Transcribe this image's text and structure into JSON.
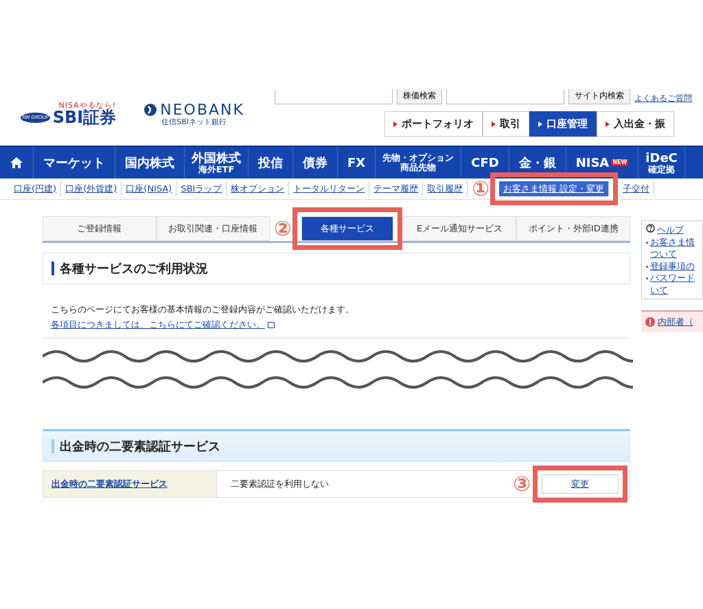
{
  "header": {
    "logo_tagline": "NISAやるなら!",
    "logo_group": "SBI GROUP",
    "logo_name": "SBI証券",
    "bank_name": "NEOBANK",
    "bank_sub": "住信SBIネット銀行",
    "search_buttons": [
      "株価検索",
      "サイト内検索"
    ],
    "faq_link": "よくあるご質問",
    "nav_buttons": [
      {
        "label": "ポートフォリオ",
        "selected": false
      },
      {
        "label": "取引",
        "selected": false
      },
      {
        "label": "口座管理",
        "selected": true
      },
      {
        "label": "入出金・振",
        "selected": false
      }
    ]
  },
  "main_nav": [
    {
      "kind": "home"
    },
    {
      "kind": "text",
      "lines": [
        "マーケット"
      ]
    },
    {
      "kind": "text",
      "lines": [
        "国内株式"
      ]
    },
    {
      "kind": "text",
      "lines": [
        "外国株式",
        "海外ETF"
      ]
    },
    {
      "kind": "text",
      "lines": [
        "投信"
      ]
    },
    {
      "kind": "text",
      "lines": [
        "債券"
      ]
    },
    {
      "kind": "text",
      "lines": [
        "FX"
      ]
    },
    {
      "kind": "text",
      "lines": [
        "先物・オプション",
        "商品先物"
      ]
    },
    {
      "kind": "text",
      "lines": [
        "CFD"
      ]
    },
    {
      "kind": "text",
      "lines": [
        "金・銀"
      ]
    },
    {
      "kind": "badge",
      "lines": [
        "NISA"
      ],
      "badge": "NEW"
    },
    {
      "kind": "text",
      "lines": [
        "iDeC",
        "確定拠"
      ]
    }
  ],
  "sub_nav": [
    {
      "label": "口座(円建)",
      "selected": false
    },
    {
      "label": "口座(外貨建)",
      "selected": false
    },
    {
      "label": "口座(NISA)",
      "selected": false
    },
    {
      "label": "SBIラップ",
      "selected": false
    },
    {
      "label": "株オプション",
      "selected": false
    },
    {
      "label": "トータルリターン",
      "selected": false
    },
    {
      "label": "テーマ履歴",
      "selected": false
    },
    {
      "label": "取引履歴",
      "selected": false
    },
    {
      "label": "お客さま情報 設定・変更",
      "selected": true,
      "annotation": "①"
    },
    {
      "label": "子交付",
      "selected": false
    }
  ],
  "tabs": [
    {
      "label": "ご登録情報",
      "selected": false
    },
    {
      "label": "お取引関連・口座情報",
      "selected": false
    },
    {
      "label": "各種サービス",
      "selected": true,
      "annotation": "②"
    },
    {
      "label": "Eメール通知サービス",
      "selected": false
    },
    {
      "label": "ポイント・外部ID連携",
      "selected": false
    }
  ],
  "usage_section": {
    "title": "各種サービスのご利用状況",
    "text": "こちらのページにてお客様の基本情報のご登録内容がご確認いただけます。",
    "link": "各項目につきましては、こちらにてご確認ください。"
  },
  "auth_section": {
    "title": "出金時の二要素認証サービス",
    "row": {
      "label": "出金時の二要素認証サービス",
      "value": "二要素認証を利用しない",
      "button": "変更",
      "annotation": "③"
    }
  },
  "sidebar": {
    "help_title": "ヘルプ",
    "links": [
      [
        "お客さま情",
        "ついて"
      ],
      [
        "登録事項の"
      ],
      [
        "パスワード",
        "いて"
      ]
    ],
    "notice": "内部者（"
  }
}
